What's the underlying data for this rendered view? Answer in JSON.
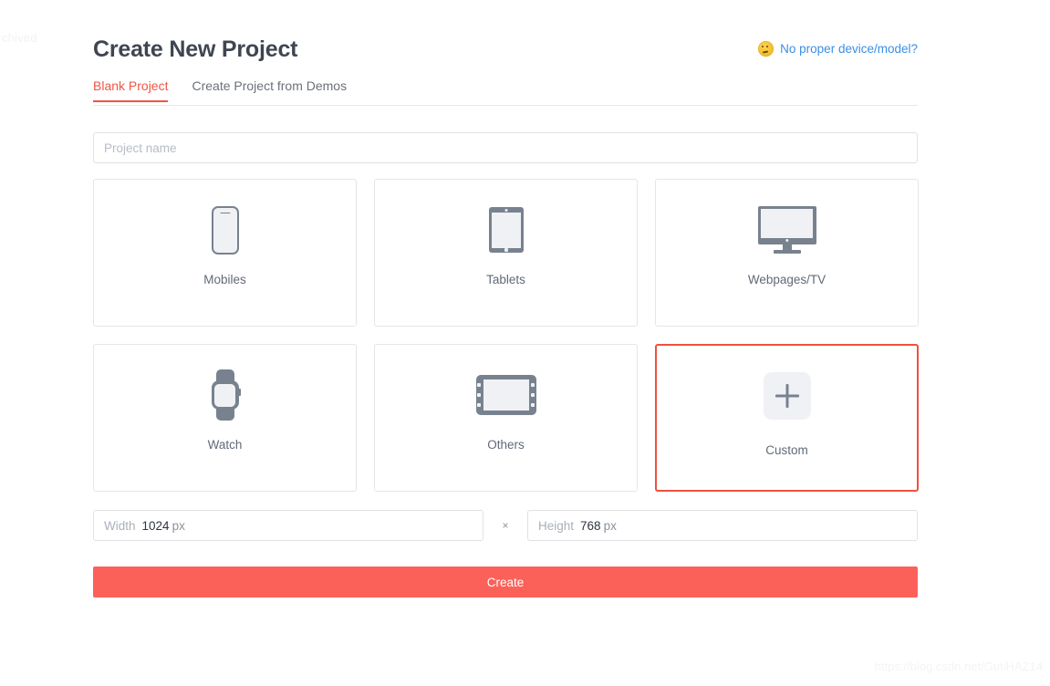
{
  "window": {
    "title": "Create New Project",
    "corner_artifact": "chived"
  },
  "header": {
    "title": "Create New Project",
    "help_link": "No proper device/model?",
    "help_icon": "thinking-face-emoji-icon",
    "link_color": "#3a8ee6"
  },
  "tabs": [
    {
      "label": "Blank Project",
      "active": true
    },
    {
      "label": "Create Project from Demos",
      "active": false
    }
  ],
  "project_name": {
    "placeholder": "Project name",
    "value": ""
  },
  "devices": [
    {
      "label": "Mobiles",
      "icon": "phone-icon",
      "selected": false
    },
    {
      "label": "Tablets",
      "icon": "tablet-icon",
      "selected": false
    },
    {
      "label": "Webpages/TV",
      "icon": "monitor-icon",
      "selected": false
    },
    {
      "label": "Watch",
      "icon": "watch-icon",
      "selected": false
    },
    {
      "label": "Others",
      "icon": "landscape-device-icon",
      "selected": false
    },
    {
      "label": "Custom",
      "icon": "plus-icon",
      "selected": true
    }
  ],
  "size": {
    "width_label": "Width",
    "width_value": "1024",
    "width_unit": "px",
    "separator": "×",
    "height_label": "Height",
    "height_value": "768",
    "height_unit": "px"
  },
  "actions": {
    "create_label": "Create",
    "create_color": "#fc6159"
  },
  "watermark": "https://blog.csdn.net/GutiHAZ14",
  "theme": {
    "accent": "#f05543",
    "icon_gray": "#78828f",
    "border": "#e3e6ea"
  }
}
